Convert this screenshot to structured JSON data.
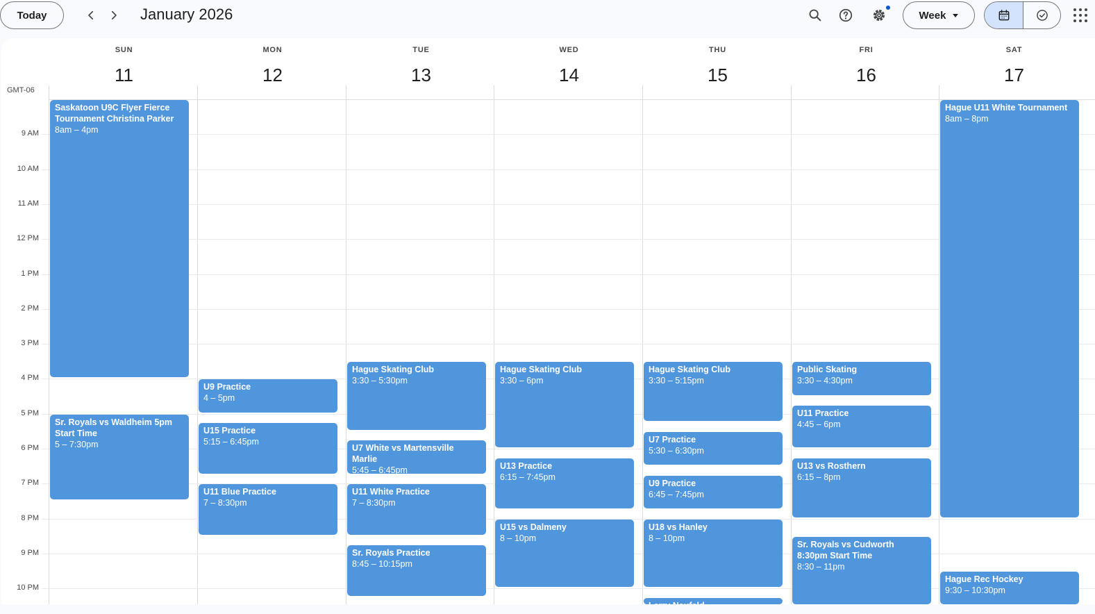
{
  "header": {
    "today_label": "Today",
    "title": "January 2026",
    "view_label": "Week",
    "icons": {
      "prev": "chevron-left-icon",
      "next": "chevron-right-icon",
      "search": "search-icon",
      "help": "help-icon",
      "settings": "gear-icon",
      "calendar_view": "calendar-icon",
      "tasks_view": "check-circle-icon",
      "apps": "apps-grid-icon"
    }
  },
  "timezone": "GMT-06",
  "colors": {
    "event": "#5096dd",
    "accent": "#0b57d0",
    "selected_segment": "#d3e3fd"
  },
  "days": [
    {
      "dow": "SUN",
      "num": "11"
    },
    {
      "dow": "MON",
      "num": "12"
    },
    {
      "dow": "TUE",
      "num": "13"
    },
    {
      "dow": "WED",
      "num": "14"
    },
    {
      "dow": "THU",
      "num": "15"
    },
    {
      "dow": "FRI",
      "num": "16"
    },
    {
      "dow": "SAT",
      "num": "17"
    }
  ],
  "hour_labels": [
    "9 AM",
    "10 AM",
    "11 AM",
    "12 PM",
    "1 PM",
    "2 PM",
    "3 PM",
    "4 PM",
    "5 PM",
    "6 PM",
    "7 PM",
    "8 PM",
    "9 PM",
    "10 PM"
  ],
  "events": [
    {
      "day": 0,
      "start": 8,
      "end": 16,
      "title": "Saskatoon U9C Flyer Fierce Tournament Christina Parker",
      "time": "8am – 4pm"
    },
    {
      "day": 0,
      "start": 17,
      "end": 19.5,
      "title": "Sr. Royals vs Waldheim 5pm Start Time",
      "time": "5 – 7:30pm"
    },
    {
      "day": 1,
      "start": 16,
      "end": 17,
      "title": "U9 Practice",
      "time": "4 – 5pm"
    },
    {
      "day": 1,
      "start": 17.25,
      "end": 18.75,
      "title": "U15 Practice",
      "time": "5:15 – 6:45pm"
    },
    {
      "day": 1,
      "start": 19,
      "end": 20.5,
      "title": "U11 Blue Practice",
      "time": "7 – 8:30pm"
    },
    {
      "day": 2,
      "start": 15.5,
      "end": 17.5,
      "title": "Hague Skating Club",
      "time": "3:30 – 5:30pm"
    },
    {
      "day": 2,
      "start": 17.75,
      "end": 18.75,
      "title": "U7 White vs Martensville Marlie",
      "time": "5:45 – 6:45pm"
    },
    {
      "day": 2,
      "start": 19,
      "end": 20.5,
      "title": "U11 White Practice",
      "time": "7 – 8:30pm"
    },
    {
      "day": 2,
      "start": 20.75,
      "end": 22.25,
      "title": "Sr. Royals Practice",
      "time": "8:45 – 10:15pm"
    },
    {
      "day": 3,
      "start": 15.5,
      "end": 18,
      "title": "Hague Skating Club",
      "time": "3:30 – 6pm"
    },
    {
      "day": 3,
      "start": 18.25,
      "end": 19.75,
      "title": "U13 Practice",
      "time": "6:15 – 7:45pm"
    },
    {
      "day": 3,
      "start": 20,
      "end": 22,
      "title": "U15 vs Dalmeny",
      "time": "8 – 10pm"
    },
    {
      "day": 4,
      "start": 15.5,
      "end": 17.25,
      "title": "Hague Skating Club",
      "time": "3:30 – 5:15pm"
    },
    {
      "day": 4,
      "start": 17.5,
      "end": 18.5,
      "title": "U7 Practice",
      "time": "5:30 – 6:30pm"
    },
    {
      "day": 4,
      "start": 18.75,
      "end": 19.75,
      "title": "U9 Practice",
      "time": "6:45 – 7:45pm"
    },
    {
      "day": 4,
      "start": 20,
      "end": 22,
      "title": "U18 vs Hanley",
      "time": "8 – 10pm"
    },
    {
      "day": 4,
      "start": 22.25,
      "end": 23.5,
      "title": "Larry Neufeld",
      "time": ""
    },
    {
      "day": 5,
      "start": 15.5,
      "end": 16.5,
      "title": "Public Skating",
      "time": "3:30 – 4:30pm"
    },
    {
      "day": 5,
      "start": 16.75,
      "end": 18,
      "title": "U11 Practice",
      "time": "4:45 – 6pm"
    },
    {
      "day": 5,
      "start": 18.25,
      "end": 20,
      "title": "U13 vs Rosthern",
      "time": "6:15 – 8pm"
    },
    {
      "day": 5,
      "start": 20.5,
      "end": 23,
      "title": "Sr. Royals vs Cudworth 8:30pm Start Time",
      "time": "8:30 – 11pm"
    },
    {
      "day": 6,
      "start": 8,
      "end": 20,
      "title": "Hague U11 White Tournament",
      "time": "8am – 8pm"
    },
    {
      "day": 6,
      "start": 21.5,
      "end": 22.5,
      "title": "Hague Rec Hockey",
      "time": "9:30 – 10:30pm"
    }
  ]
}
